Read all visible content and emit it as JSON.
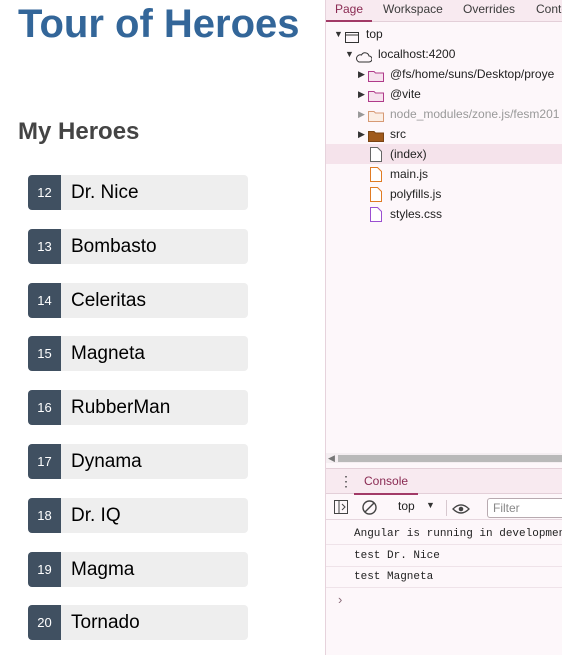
{
  "app": {
    "title": "Tour of Heroes",
    "subtitle": "My Heroes",
    "heroes": [
      {
        "id": "12",
        "name": "Dr. Nice"
      },
      {
        "id": "13",
        "name": "Bombasto"
      },
      {
        "id": "14",
        "name": "Celeritas"
      },
      {
        "id": "15",
        "name": "Magneta"
      },
      {
        "id": "16",
        "name": "RubberMan"
      },
      {
        "id": "17",
        "name": "Dynama"
      },
      {
        "id": "18",
        "name": "Dr. IQ"
      },
      {
        "id": "19",
        "name": "Magma"
      },
      {
        "id": "20",
        "name": "Tornado"
      }
    ]
  },
  "devtools": {
    "tabs": [
      "Page",
      "Workspace",
      "Overrides",
      "Conte"
    ],
    "tree": {
      "top": "top",
      "host": "localhost:4200",
      "folders": [
        "@fs/home/suns/Desktop/proye",
        "@vite",
        "node_modules/zone.js/fesm201",
        "src"
      ],
      "files": [
        "(index)",
        "main.js",
        "polyfills.js",
        "styles.css"
      ]
    },
    "drawer_tab": "Console",
    "context": "top",
    "filter_placeholder": "Filter",
    "messages": [
      "Angular is running in developmen",
      "test Dr. Nice",
      "test Magneta"
    ],
    "prompt": "›",
    "colors": {
      "accent": "#a23a67",
      "hero_title": "#336699",
      "badge": "#405061"
    }
  }
}
